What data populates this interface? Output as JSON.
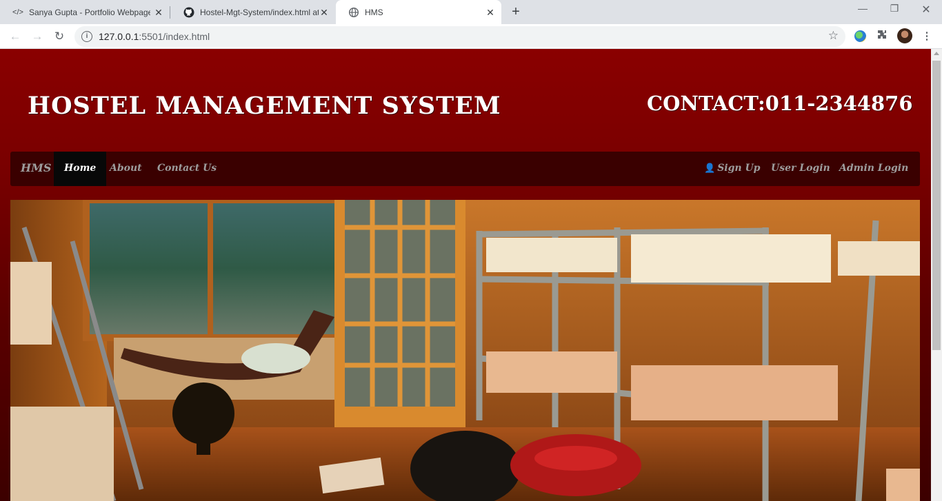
{
  "browser": {
    "tabs": [
      {
        "title": "Sanya Gupta - Portfolio Webpage",
        "icon": "code-icon",
        "active": false
      },
      {
        "title": "Hostel-Mgt-System/index.html at",
        "icon": "github-icon",
        "active": false
      },
      {
        "title": "HMS",
        "icon": "globe-icon",
        "active": true
      }
    ],
    "address": {
      "host": "127.0.0.1",
      "path": ":5501/index.html"
    }
  },
  "page": {
    "site_title": "HOSTEL MANAGEMENT SYSTEM",
    "contact": "CONTACT:011-2344876",
    "nav": {
      "brand": "HMS",
      "left": [
        "Home",
        "About",
        "Contact Us"
      ],
      "right": [
        "Sign Up",
        "User Login",
        "Admin Login"
      ]
    },
    "hero_alt": "hostel-bunk-room-photo"
  },
  "colors": {
    "header_bg": "#8a0000",
    "navbar_bg": "#3a0000",
    "nav_active_bg": "#080808",
    "nav_text": "#9d9d9d"
  }
}
